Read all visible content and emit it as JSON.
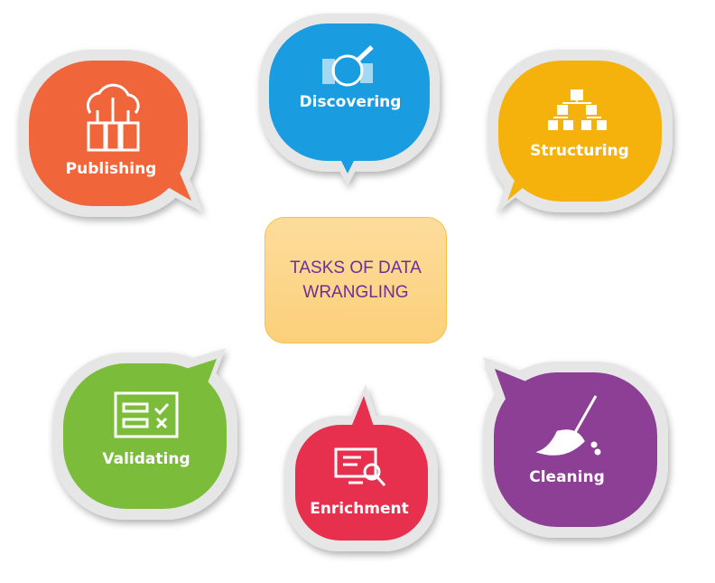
{
  "center": {
    "title": "TASKS OF DATA WRANGLING",
    "color": "#6a2f9a",
    "fill": "#fdd98f"
  },
  "bubbles": [
    {
      "label": "Publishing",
      "icon": "cloud-servers-icon",
      "color": "#f1653b"
    },
    {
      "label": "Discovering",
      "icon": "magnifier-binary-icon",
      "color": "#1a9de0"
    },
    {
      "label": "Structuring",
      "icon": "hierarchy-icon",
      "color": "#f6b20c"
    },
    {
      "label": "Validating",
      "icon": "checklist-icon",
      "color": "#7bbd3b"
    },
    {
      "label": "Enrichment",
      "icon": "monitor-search-icon",
      "color": "#e6304d"
    },
    {
      "label": "Cleaning",
      "icon": "broom-icon",
      "color": "#8d3f95"
    }
  ]
}
